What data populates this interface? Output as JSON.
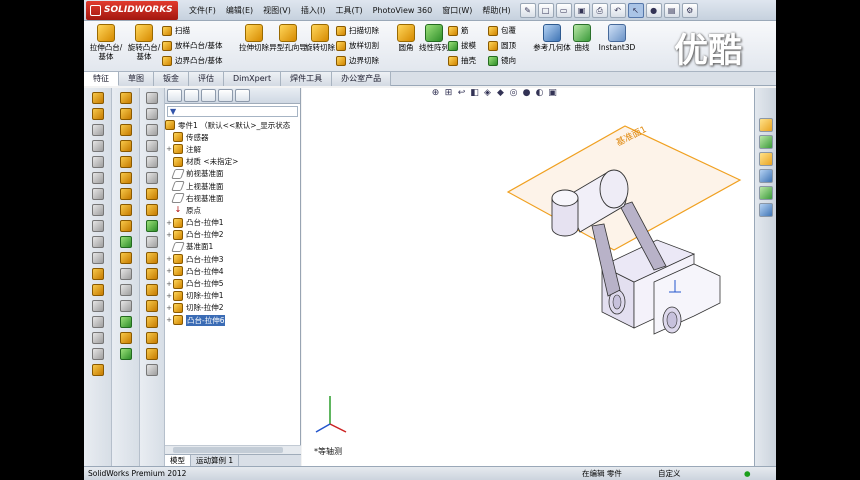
{
  "app": {
    "logo": "SOLIDWORKS"
  },
  "menu": [
    "文件(F)",
    "编辑(E)",
    "视图(V)",
    "插入(I)",
    "工具(T)",
    "PhotoView 360",
    "窗口(W)",
    "帮助(H)"
  ],
  "command_manager": {
    "big_buttons": [
      "拉伸凸台/基体",
      "旋转凸台/基体",
      "拉伸切除",
      "异型孔向导",
      "旋转切除",
      "圆角",
      "线性阵列",
      "参考几何体",
      "曲线",
      "Instant3D"
    ],
    "col1": [
      "扫描",
      "放样凸台/基体",
      "边界凸台/基体"
    ],
    "col2": [
      "扫描切除",
      "放样切割",
      "边界切除"
    ],
    "col3": [
      "筋",
      "拔模",
      "抽壳"
    ],
    "col4": [
      "包覆",
      "圆顶",
      "镜向"
    ]
  },
  "watermark": "优酷",
  "tabs": [
    "特征",
    "草图",
    "钣金",
    "评估",
    "DimXpert",
    "焊件工具",
    "办公室产品"
  ],
  "feature_tree": {
    "root": "零件1 （默认<<默认>_显示状态",
    "items": [
      {
        "label": "传感器",
        "icon": "sensor-icon",
        "expand": ""
      },
      {
        "label": "注解",
        "icon": "annotation-icon",
        "expand": "+"
      },
      {
        "label": "材质 <未指定>",
        "icon": "material-icon",
        "expand": ""
      },
      {
        "label": "前视基准面",
        "icon": "plane-icon",
        "expand": ""
      },
      {
        "label": "上视基准面",
        "icon": "plane-icon",
        "expand": ""
      },
      {
        "label": "右视基准面",
        "icon": "plane-icon",
        "expand": ""
      },
      {
        "label": "原点",
        "icon": "origin-icon",
        "expand": ""
      },
      {
        "label": "凸台-拉伸1",
        "icon": "boss-extrude-icon",
        "expand": "+"
      },
      {
        "label": "凸台-拉伸2",
        "icon": "boss-extrude-icon",
        "expand": "+"
      },
      {
        "label": "基准面1",
        "icon": "plane-icon",
        "expand": ""
      },
      {
        "label": "凸台-拉伸3",
        "icon": "boss-extrude-icon",
        "expand": "+"
      },
      {
        "label": "凸台-拉伸4",
        "icon": "boss-extrude-icon",
        "expand": "+"
      },
      {
        "label": "凸台-拉伸5",
        "icon": "boss-extrude-icon",
        "expand": "+"
      },
      {
        "label": "切除-拉伸1",
        "icon": "cut-extrude-icon",
        "expand": "+"
      },
      {
        "label": "切除-拉伸2",
        "icon": "cut-extrude-icon",
        "expand": "+"
      },
      {
        "label": "凸台-拉伸6",
        "icon": "boss-extrude-icon",
        "expand": "+",
        "selected": true
      }
    ]
  },
  "fm_bottom_tabs": [
    "模型",
    "运动算例 1"
  ],
  "graphics": {
    "plane_label": "基准面1",
    "view_label": "*等轴测"
  },
  "status": {
    "product": "SolidWorks Premium 2012",
    "mode": "在编辑 零件",
    "units": "自定义",
    "indicator": "●"
  },
  "colors": {
    "accent": "#f0a020",
    "selection": "#3b6cb5",
    "part_face": "#ece9f6"
  }
}
